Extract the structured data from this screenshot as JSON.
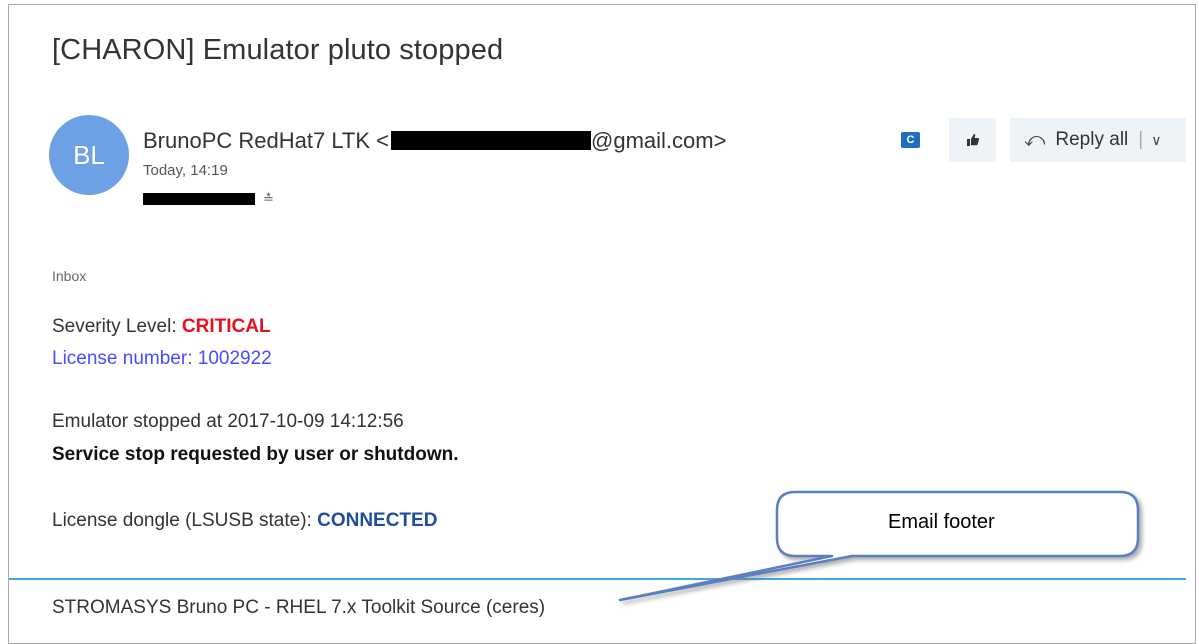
{
  "email": {
    "subject": "[CHARON] Emulator pluto stopped",
    "avatar_initials": "BL",
    "sender_name": "BrunoPC RedHat7 LTK <",
    "sender_domain": "@gmail.com>",
    "date": "Today, 14:19",
    "folder": "Inbox"
  },
  "toolbar": {
    "outlook_icon": "outlook-icon",
    "like_icon": "thumbs-up-icon",
    "reply_all_label": "Reply all",
    "reply_icon": "reply-all-icon",
    "dropdown_icon": "chevron-down-icon"
  },
  "body": {
    "severity_label": "Severity Level: ",
    "severity_value": "CRITICAL",
    "license_line": "License number: 1002922",
    "stopped_line": "Emulator stopped at 2017-10-09 14:12:56",
    "service_line": "Service stop requested by user or shutdown.",
    "dongle_label": "License dongle (LSUSB state): ",
    "dongle_value": "CONNECTED",
    "footer": "STROMASYS Bruno PC - RHEL 7.x Toolkit Source (ceres)"
  },
  "annotation": {
    "callout_text": "Email footer"
  },
  "colors": {
    "avatar": "#6ea0e6",
    "critical": "#e8101d",
    "license": "#4b4bff",
    "connected": "#1f4e9a",
    "divider": "#3fa9e8",
    "callout_border": "#5b7fbf"
  }
}
